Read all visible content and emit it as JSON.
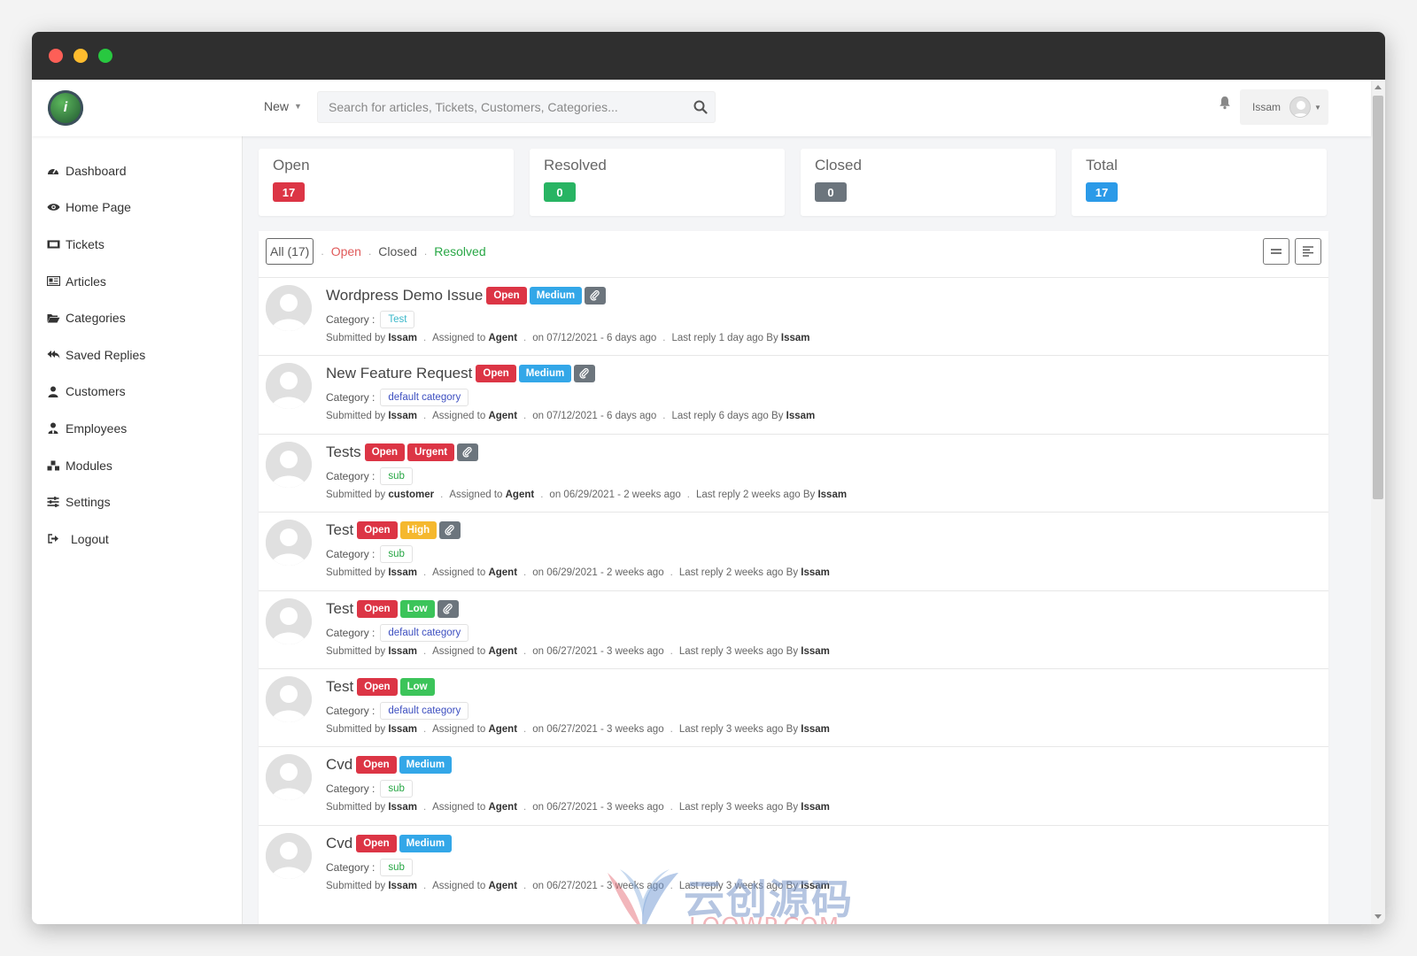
{
  "colors": {
    "open": "#dc3545",
    "resolved": "#28b463",
    "closed": "#6c757d",
    "total": "#2b9ae8",
    "medium": "#33a7e8",
    "urgent": "#dc3545",
    "high": "#f5b82e",
    "low": "#3cc45a",
    "filter_open": "#e05a5a",
    "filter_resolved": "#28a745",
    "cat_test": "#3ab7c9",
    "cat_default": "#3d4fc0",
    "cat_sub": "#28a745"
  },
  "topbar": {
    "logo_letter": "i",
    "new_label": "New",
    "search_placeholder": "Search for articles, Tickets, Customers, Categories...",
    "user_name": "Issam"
  },
  "sidebar": {
    "items": [
      {
        "label": "Dashboard",
        "icon": "dashboard-icon"
      },
      {
        "label": "Home Page",
        "icon": "eye-icon"
      },
      {
        "label": "Tickets",
        "icon": "ticket-icon"
      },
      {
        "label": "Articles",
        "icon": "newspaper-icon"
      },
      {
        "label": "Categories",
        "icon": "folder-open-icon"
      },
      {
        "label": "Saved Replies",
        "icon": "reply-all-icon"
      },
      {
        "label": "Customers",
        "icon": "user-icon"
      },
      {
        "label": "Employees",
        "icon": "user-tie-icon"
      },
      {
        "label": "Modules",
        "icon": "cubes-icon"
      },
      {
        "label": "Settings",
        "icon": "sliders-icon"
      },
      {
        "label": "Logout",
        "icon": "sign-out-icon"
      }
    ]
  },
  "stats": [
    {
      "label": "Open",
      "count": "17",
      "color": "#dc3545"
    },
    {
      "label": "Resolved",
      "count": "0",
      "color": "#28b463"
    },
    {
      "label": "Closed",
      "count": "0",
      "color": "#6c757d"
    },
    {
      "label": "Total",
      "count": "17",
      "color": "#2b9ae8"
    }
  ],
  "filters": {
    "all": "All (17)",
    "open": "Open",
    "closed": "Closed",
    "resolved": "Resolved",
    "dot": "."
  },
  "ticket_labels": {
    "category": "Category :",
    "submitted_by": "Submitted by",
    "assigned_to": "Assigned to",
    "on": "on",
    "last_reply": "Last reply",
    "by": "By",
    "dot": "."
  },
  "tickets": [
    {
      "title": "Wordpress Demo Issue",
      "status": "Open",
      "priority": "Medium",
      "priority_color": "#33a7e8",
      "attachment": true,
      "category": "Test",
      "category_color": "#3ab7c9",
      "submitter": "Issam",
      "agent": "Agent",
      "date": "07/12/2021 - 6 days ago",
      "last_reply": "1 day ago",
      "reply_by": "Issam"
    },
    {
      "title": "New Feature Request",
      "status": "Open",
      "priority": "Medium",
      "priority_color": "#33a7e8",
      "attachment": true,
      "category": "default category",
      "category_color": "#3d4fc0",
      "submitter": "Issam",
      "agent": "Agent",
      "date": "07/12/2021 - 6 days ago",
      "last_reply": "6 days ago",
      "reply_by": "Issam"
    },
    {
      "title": "Tests",
      "status": "Open",
      "priority": "Urgent",
      "priority_color": "#dc3545",
      "attachment": true,
      "category": "sub",
      "category_color": "#28a745",
      "submitter": "customer",
      "agent": "Agent",
      "date": "06/29/2021 - 2 weeks ago",
      "last_reply": "2 weeks ago",
      "reply_by": "Issam"
    },
    {
      "title": "Test",
      "status": "Open",
      "priority": "High",
      "priority_color": "#f5b82e",
      "attachment": true,
      "category": "sub",
      "category_color": "#28a745",
      "submitter": "Issam",
      "agent": "Agent",
      "date": "06/29/2021 - 2 weeks ago",
      "last_reply": "2 weeks ago",
      "reply_by": "Issam"
    },
    {
      "title": "Test",
      "status": "Open",
      "priority": "Low",
      "priority_color": "#3cc45a",
      "attachment": true,
      "category": "default category",
      "category_color": "#3d4fc0",
      "submitter": "Issam",
      "agent": "Agent",
      "date": "06/27/2021 - 3 weeks ago",
      "last_reply": "3 weeks ago",
      "reply_by": "Issam"
    },
    {
      "title": "Test",
      "status": "Open",
      "priority": "Low",
      "priority_color": "#3cc45a",
      "attachment": false,
      "category": "default category",
      "category_color": "#3d4fc0",
      "submitter": "Issam",
      "agent": "Agent",
      "date": "06/27/2021 - 3 weeks ago",
      "last_reply": "3 weeks ago",
      "reply_by": "Issam"
    },
    {
      "title": "Cvd",
      "status": "Open",
      "priority": "Medium",
      "priority_color": "#33a7e8",
      "attachment": false,
      "category": "sub",
      "category_color": "#28a745",
      "submitter": "Issam",
      "agent": "Agent",
      "date": "06/27/2021 - 3 weeks ago",
      "last_reply": "3 weeks ago",
      "reply_by": "Issam"
    },
    {
      "title": "Cvd",
      "status": "Open",
      "priority": "Medium",
      "priority_color": "#33a7e8",
      "attachment": false,
      "category": "sub",
      "category_color": "#28a745",
      "submitter": "Issam",
      "agent": "Agent",
      "date": "06/27/2021 - 3 weeks ago",
      "last_reply": "3 weeks ago",
      "reply_by": "Issam"
    }
  ],
  "watermark": {
    "main": "云创源码",
    "sub": "LOOWP.COM"
  }
}
